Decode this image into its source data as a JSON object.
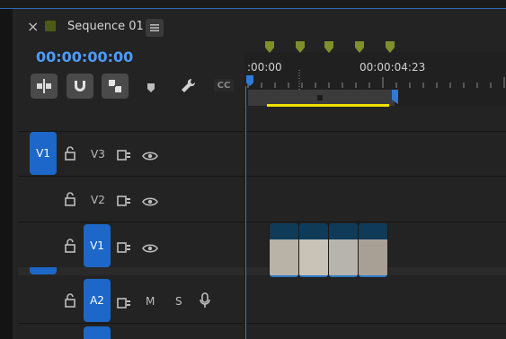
{
  "panel": {
    "close_label": "×",
    "tab_title": "Sequence 01",
    "timecode": "00:00:00:00"
  },
  "ruler": {
    "label_start": ":00:00",
    "label_mid": "00:00:04:23"
  },
  "toolbar": {
    "cc_label": "CC"
  },
  "tracks": {
    "v3": {
      "target": "V1",
      "name": "V3"
    },
    "v2": {
      "name": "V2"
    },
    "v1": {
      "target": "V1",
      "name": "V1"
    },
    "a2": {
      "target": "A2",
      "m": "M",
      "s": "S"
    }
  },
  "colors": {
    "accent_blue": "#1c67c7",
    "playhead_blue": "#2f79d8",
    "yellow_bar": "#f0e000",
    "timecode_blue": "#4c9bff"
  },
  "icons": {
    "lock": "lock-icon",
    "sync": "sync-lock-icon",
    "eye": "eye-icon",
    "mic": "mic-icon",
    "wrench": "wrench-icon",
    "marker": "marker-icon",
    "snap": "snap-magnet-icon",
    "linked": "linked-selection-icon",
    "insert": "insert-edit-icon",
    "menu": "panel-menu-icon"
  }
}
